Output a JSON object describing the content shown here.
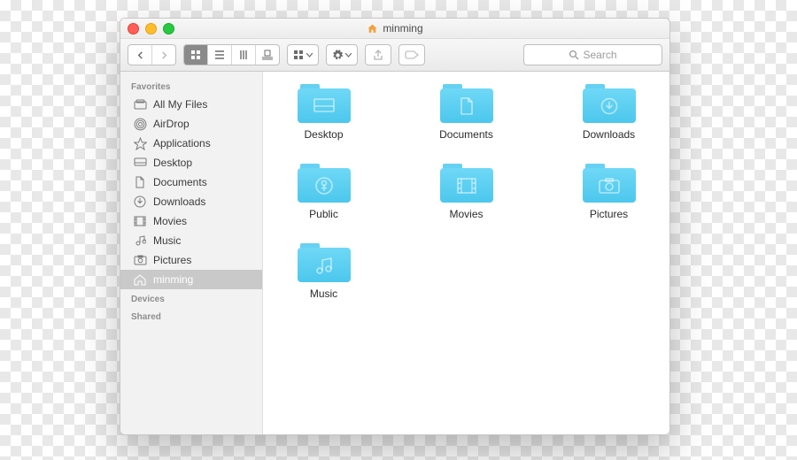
{
  "window": {
    "title": "minming",
    "title_icon": "home-icon"
  },
  "toolbar": {
    "search_placeholder": "Search"
  },
  "sidebar": {
    "sections": [
      {
        "header": "Favorites",
        "items": [
          {
            "icon": "all-my-files-icon",
            "label": "All My Files"
          },
          {
            "icon": "airdrop-icon",
            "label": "AirDrop"
          },
          {
            "icon": "applications-icon",
            "label": "Applications"
          },
          {
            "icon": "desktop-icon",
            "label": "Desktop"
          },
          {
            "icon": "documents-icon",
            "label": "Documents"
          },
          {
            "icon": "downloads-icon",
            "label": "Downloads"
          },
          {
            "icon": "movies-icon",
            "label": "Movies"
          },
          {
            "icon": "music-icon",
            "label": "Music"
          },
          {
            "icon": "pictures-icon",
            "label": "Pictures"
          },
          {
            "icon": "home-icon",
            "label": "minming",
            "selected": true
          }
        ]
      },
      {
        "header": "Devices",
        "items": []
      },
      {
        "header": "Shared",
        "items": []
      }
    ]
  },
  "content": {
    "items": [
      {
        "label": "Desktop",
        "glyph": "desktop"
      },
      {
        "label": "Documents",
        "glyph": "documents"
      },
      {
        "label": "Downloads",
        "glyph": "downloads"
      },
      {
        "label": "Public",
        "glyph": "public"
      },
      {
        "label": "Movies",
        "glyph": "movies"
      },
      {
        "label": "Pictures",
        "glyph": "pictures"
      },
      {
        "label": "Music",
        "glyph": "music"
      }
    ]
  }
}
